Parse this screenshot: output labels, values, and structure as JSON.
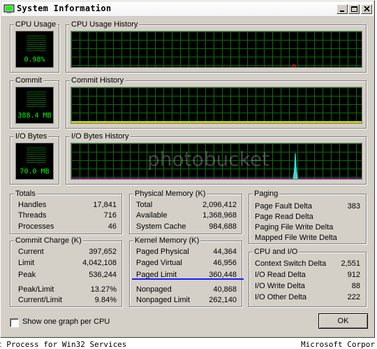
{
  "window": {
    "title": "System Information"
  },
  "checkbox": {
    "label": "Show one graph per CPU",
    "checked": false
  },
  "ok_button": {
    "label": "OK"
  },
  "cpu_usage": {
    "label": "CPU Usage",
    "value": "0.98%"
  },
  "cpu_history": {
    "label": "CPU Usage History"
  },
  "commit": {
    "label": "Commit",
    "value": "388.4 MB"
  },
  "commit_history": {
    "label": "Commit History"
  },
  "io_bytes": {
    "label": "I/O Bytes",
    "value": "70.0  MB"
  },
  "io_history": {
    "label": "I/O Bytes History"
  },
  "totals": {
    "label": "Totals",
    "rows": [
      {
        "name": "Handles",
        "value": "17,841"
      },
      {
        "name": "Threads",
        "value": "716"
      },
      {
        "name": "Processes",
        "value": "46"
      }
    ]
  },
  "physical_memory": {
    "label": "Physical Memory (K)",
    "rows": [
      {
        "name": "Total",
        "value": "2,096,412"
      },
      {
        "name": "Available",
        "value": "1,368,968"
      },
      {
        "name": "System Cache",
        "value": "984,688"
      }
    ]
  },
  "paging": {
    "label": "Paging",
    "rows": [
      {
        "name": "Page Fault Delta",
        "value": "383"
      },
      {
        "name": "Page Read Delta",
        "value": ""
      },
      {
        "name": "Paging File Write Delta",
        "value": ""
      },
      {
        "name": "Mapped File Write Delta",
        "value": ""
      }
    ]
  },
  "commit_charge": {
    "label": "Commit Charge (K)",
    "rows": [
      {
        "name": "Current",
        "value": "397,652"
      },
      {
        "name": "Limit",
        "value": "4,042,108"
      },
      {
        "name": "Peak",
        "value": "536,244"
      },
      {
        "name": "Peak/Limit",
        "value": "13.27%"
      },
      {
        "name": "Current/Limit",
        "value": "9.84%"
      }
    ]
  },
  "kernel_memory": {
    "label": "Kernel Memory (K)",
    "rows": [
      {
        "name": "Paged Physical",
        "value": "44,364"
      },
      {
        "name": "Paged Virtual",
        "value": "46,956"
      },
      {
        "name": "Paged Limit",
        "value": "360,448"
      },
      {
        "name": "Nonpaged",
        "value": "40,868"
      },
      {
        "name": "Nonpaged Limit",
        "value": "262,140"
      }
    ]
  },
  "cpu_io": {
    "label": "CPU and I/O",
    "rows": [
      {
        "name": "Context Switch Delta",
        "value": "2,551"
      },
      {
        "name": "I/O Read Delta",
        "value": "912"
      },
      {
        "name": "I/O Write Delta",
        "value": "88"
      },
      {
        "name": "I/O Other Delta",
        "value": "222"
      }
    ]
  },
  "taskbar": {
    "left_text": "t Process for Win32 Services",
    "right_text": "Microsoft Corpor"
  },
  "watermark": {
    "text": "photobucket"
  },
  "colors": {
    "graph_grid": "#0a6e0a",
    "meter_text": "#00ff00",
    "cpu_line": "#ff0000",
    "commit_line": "#ffff00",
    "io_line": "#ff00ff",
    "io_spike": "#00ffff"
  }
}
